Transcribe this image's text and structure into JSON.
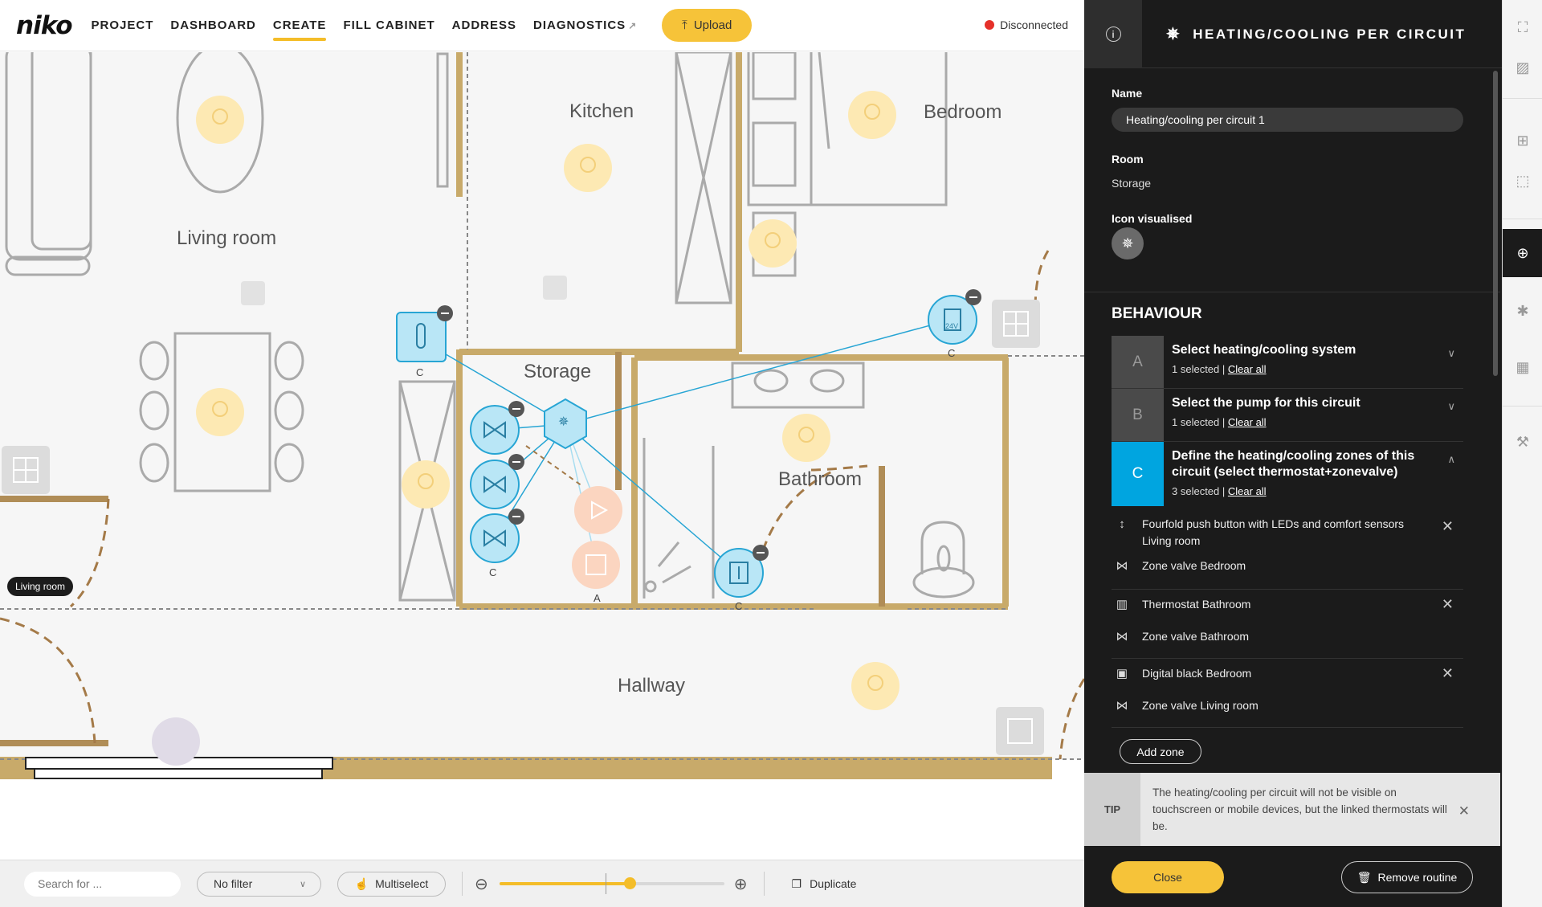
{
  "nav": {
    "logo": "niko",
    "items": [
      "PROJECT",
      "DASHBOARD",
      "CREATE",
      "FILL CABINET",
      "ADDRESS",
      "DIAGNOSTICS"
    ],
    "active": "CREATE",
    "upload_label": "Upload",
    "status_label": "Disconnected",
    "status_color": "#e5302a"
  },
  "plan": {
    "rooms": {
      "living_room": "Living room",
      "kitchen": "Kitchen",
      "bedroom": "Bedroom",
      "storage": "Storage",
      "bathroom": "Bathroom",
      "hallway": "Hallway"
    },
    "markers": {
      "thermostat_living": "C",
      "zone_valves": "C",
      "pump": "A",
      "thermostat_bathroom": "C",
      "thermostat_bedroom": "C",
      "digital_24v": "24V"
    },
    "room_pill": "Living room"
  },
  "toolbar": {
    "search_placeholder": "Search for ...",
    "filter_value": "No filter",
    "multiselect_label": "Multiselect",
    "zoom_level": 0.58,
    "duplicate_label": "Duplicate"
  },
  "panel": {
    "title": "HEATING/COOLING PER CIRCUIT",
    "name_label": "Name",
    "name_value": "Heating/cooling per circuit 1",
    "room_label": "Room",
    "room_value": "Storage",
    "icon_label": "Icon visualised",
    "behaviour_title": "BEHAVIOUR",
    "steps": [
      {
        "letter": "A",
        "title": "Select heating/cooling system",
        "selected": "1 selected |",
        "clear": "Clear all"
      },
      {
        "letter": "B",
        "title": "Select the pump for this circuit",
        "selected": "1 selected |",
        "clear": "Clear all"
      },
      {
        "letter": "C",
        "title": "Define the heating/cooling zones of this circuit (select thermostat+zonevalve)",
        "selected": "3 selected |",
        "clear": "Clear all"
      }
    ],
    "zones": [
      {
        "thermostat": "Fourfold push button with LEDs and comfort sensors",
        "thermostat_room": "Living room",
        "valve": "Zone valve Bedroom"
      },
      {
        "thermostat": "Thermostat Bathroom",
        "valve": "Zone valve Bathroom"
      },
      {
        "thermostat": "Digital black Bedroom",
        "valve": "Zone valve Living room"
      }
    ],
    "add_zone_label": "Add zone",
    "tip_label": "TIP",
    "tip_text": "The heating/cooling per circuit will not be visible on touchscreen or mobile devices, but the linked thermostats will be.",
    "close_label": "Close",
    "remove_label": "Remove routine",
    "accent_color": "#00a5e0",
    "brand_color": "#f6c339"
  }
}
